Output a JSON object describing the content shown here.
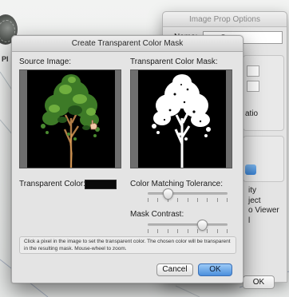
{
  "background": {
    "left_text": "PI"
  },
  "prop_window": {
    "title": "Image Prop Options",
    "name_label": "Name:",
    "name_value": "tree 5",
    "ratio_label": "atio",
    "options": [
      "ity",
      "ject",
      "o Viewer",
      "l"
    ],
    "ok_label": "OK"
  },
  "dialog": {
    "title": "Create Transparent Color Mask",
    "source_label": "Source Image:",
    "mask_label": "Transparent Color Mask:",
    "transparent_color_label": "Transparent Color:",
    "transparent_color": "#0a0a0a",
    "tolerance_label": "Color Matching Tolerance:",
    "tolerance_value": 0.25,
    "contrast_label": "Mask Contrast:",
    "contrast_value": 0.68,
    "hint": "Click a pixel in the image to set the transparent color.  The chosen color will be transparent in the resulting mask.  Mouse-wheel to zoom.",
    "cancel_label": "Cancel",
    "ok_label": "OK"
  },
  "colors": {
    "accent_blue": "#4b8fdc",
    "foliage": "#3f7a2a",
    "trunk": "#9a6a3a"
  }
}
